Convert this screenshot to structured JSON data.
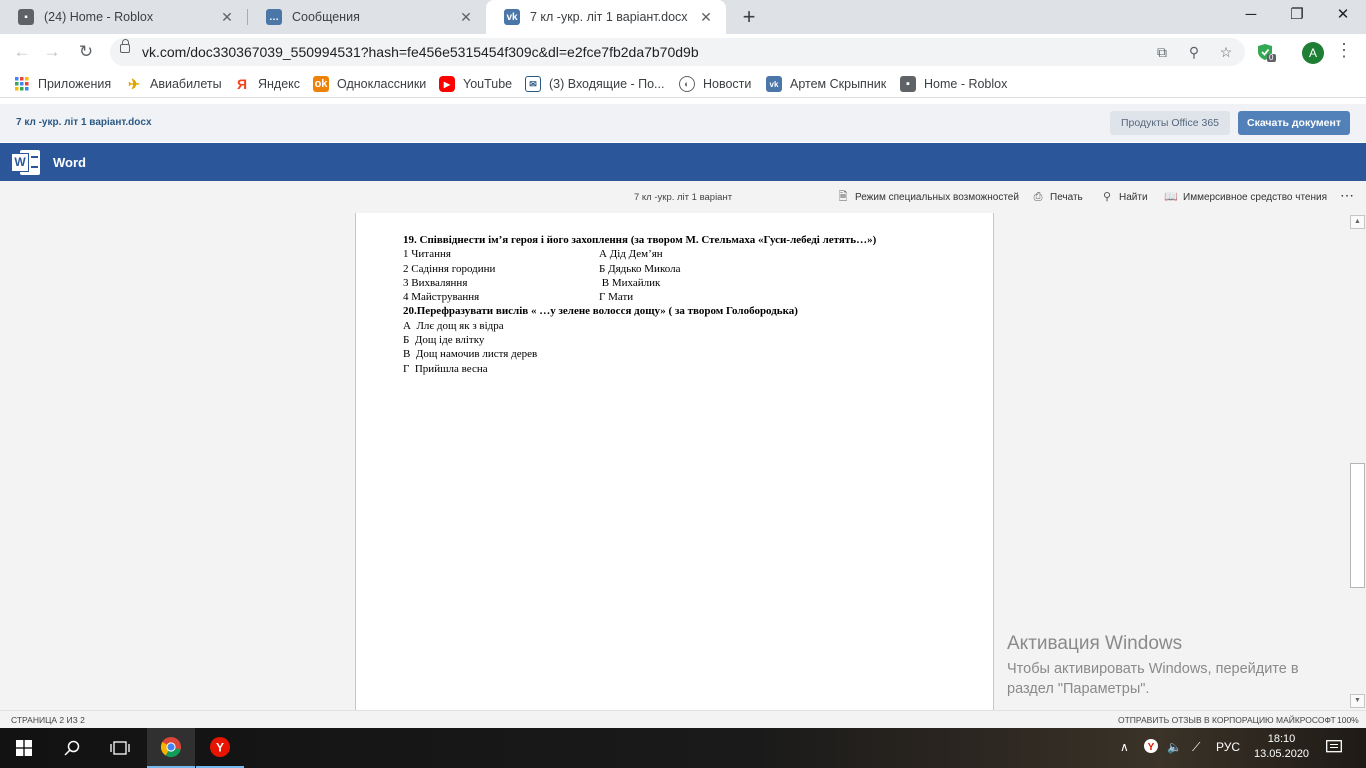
{
  "browser": {
    "tabs": [
      {
        "title": "(24) Home - Roblox",
        "favicon": "roblox-icon",
        "active": false
      },
      {
        "title": "Сообщения",
        "favicon": "vk-messages-icon",
        "active": false
      },
      {
        "title": "7 кл -укр. літ 1 варіант.docx",
        "favicon": "vk-icon",
        "active": true
      }
    ],
    "url": "vk.com/doc330367039_550994531?hash=fe456e5315454f309c&dl=e2fce7fb2da7b70d9b",
    "avatar_letter": "A",
    "extension_badge": "0",
    "bookmarks": [
      "Приложения",
      "Авиабилеты",
      "Яндекс",
      "Одноклассники",
      "YouTube",
      "(3) Входящие - По...",
      "Новости",
      "Артем Скрыпник",
      "Home - Roblox"
    ]
  },
  "vk_docbar": {
    "filename": "7 кл -укр. літ 1 варіант.docx",
    "office_button": "Продукты Office 365",
    "download_button": "Скачать документ"
  },
  "word": {
    "app_name": "Word",
    "doc_title": "7 кл -укр. літ 1 варіант",
    "ribbon": [
      "Режим специальных возможностей",
      "Печать",
      "Найти",
      "Иммерсивное средство чтения"
    ]
  },
  "document": {
    "q19_title": "19. Співвіднести ім’я героя і його захоплення (за твором М. Стельмаха «Гуси-лебеді летять…»)",
    "q19_rows": [
      {
        "left": "1 Читання",
        "right": "А Дід Дем’ян"
      },
      {
        "left": "2 Садіння городини",
        "right": "Б Дядько Микола"
      },
      {
        "left": "3 Вихваляння",
        "right": " В Михайлик"
      },
      {
        "left": "4 Майстрування",
        "right": "Г Мати"
      }
    ],
    "q20_title": "20.Перефразувати вислів « …у зелене волосся дощу» ( за твором Голобородька)",
    "q20_options": [
      "А  Ллє дощ як з відра",
      "Б  Дощ іде влітку",
      "В  Дощ намочив листя дерев",
      "Г  Прийшла весна"
    ]
  },
  "activation": {
    "title": "Активация Windows",
    "line1": "Чтобы активировать Windows, перейдите в",
    "line2": "раздел \"Параметры\"."
  },
  "statusbar": {
    "page": "СТРАНИЦА 2 ИЗ 2",
    "feedback": "ОТПРАВИТЬ ОТЗЫВ В КОРПОРАЦИЮ МАЙКРОСОФТ",
    "zoom": "100%"
  },
  "taskbar": {
    "language": "РУС",
    "time": "18:10",
    "date": "13.05.2020"
  },
  "colors": {
    "word_blue": "#2b579a",
    "vk_blue": "#5181b8",
    "chrome_tabstrip": "#dee1e6"
  }
}
